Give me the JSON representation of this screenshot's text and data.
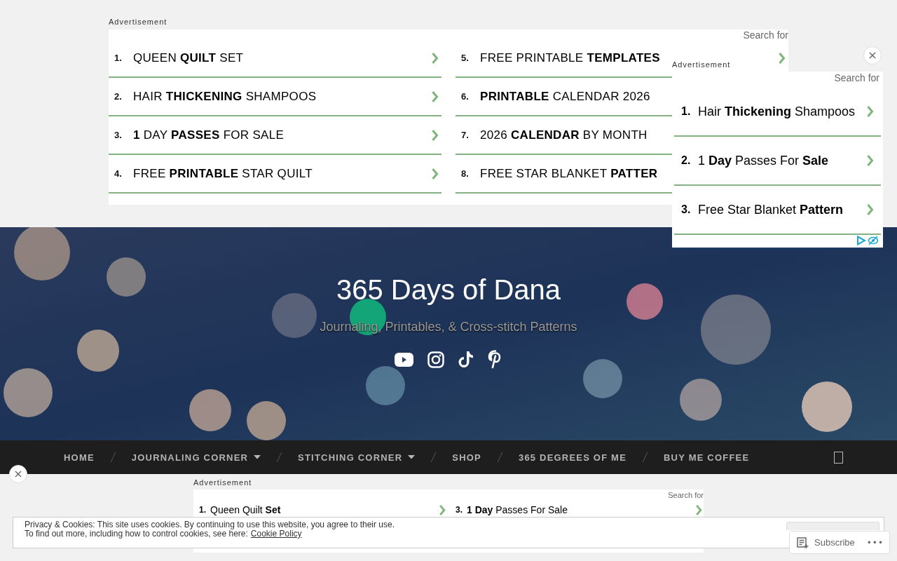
{
  "top_ad": {
    "label": "Advertisement",
    "search_label": "Search for",
    "columns": [
      [
        {
          "number": "1.",
          "text": "QUEEN **QUILT** SET",
          "arrow": true
        },
        {
          "number": "2.",
          "text": "HAIR **THICKENING** SHAMPOOS",
          "arrow": true
        },
        {
          "number": "3.",
          "text": "**1** DAY **PASSES** FOR SALE",
          "arrow": true
        },
        {
          "number": "4.",
          "text": "FREE **PRINTABLE** STAR QUILT",
          "arrow": true
        }
      ],
      [
        {
          "number": "5.",
          "text": "FREE PRINTABLE **TEMPLATES**",
          "arrow": true
        },
        {
          "number": "6.",
          "text": "**PRINTABLE** CALENDAR 2026",
          "arrow": false
        },
        {
          "number": "7.",
          "text": "2026 **CALENDAR** BY MONTH",
          "arrow": false
        },
        {
          "number": "8.",
          "text": "FREE STAR BLANKET **PATTER**",
          "arrow": false
        }
      ]
    ]
  },
  "floating_ad": {
    "label": "Advertisement",
    "search_label": "Search for",
    "close": "×",
    "items": [
      {
        "number": "1.",
        "text": "Hair **Thickening** Shampoos"
      },
      {
        "number": "2.",
        "text": "1 **Day** Passes For **Sale**"
      },
      {
        "number": "3.",
        "text": "Free Star Blanket **Pattern**"
      }
    ]
  },
  "header": {
    "title": "365 Days of Dana",
    "tagline": "Journaling, Printables, & Cross-stitch Patterns",
    "social_links": [
      {
        "kind": "youtube"
      },
      {
        "kind": "instagram"
      },
      {
        "kind": "tiktok"
      },
      {
        "kind": "pinterest"
      }
    ]
  },
  "nav": {
    "items": [
      {
        "label": "HOME",
        "has_dropdown": false
      },
      {
        "label": "JOURNALING CORNER",
        "has_dropdown": true
      },
      {
        "label": "STITCHING CORNER",
        "has_dropdown": true
      },
      {
        "label": "SHOP",
        "has_dropdown": false
      },
      {
        "label": "365 DEGREES OF ME",
        "has_dropdown": false
      },
      {
        "label": "BUY ME COFFEE",
        "has_dropdown": false
      }
    ]
  },
  "side_close": "×",
  "bottom_ad": {
    "label": "Advertisement",
    "search_label": "Search for",
    "items": [
      {
        "number": "1.",
        "text": "Queen Quilt **Set**"
      },
      {
        "number": "3.",
        "text": "**1 Day** Passes For Sale"
      }
    ]
  },
  "cookie_bar": {
    "line_1": "Privacy & Cookies: This site uses cookies. By continuing to use this website, you agree to their use.",
    "line_2": "To find out more, including how to control cookies, see here:",
    "link": "Cookie Policy"
  },
  "subscribe": {
    "label": "Subscribe",
    "more": "•••"
  }
}
